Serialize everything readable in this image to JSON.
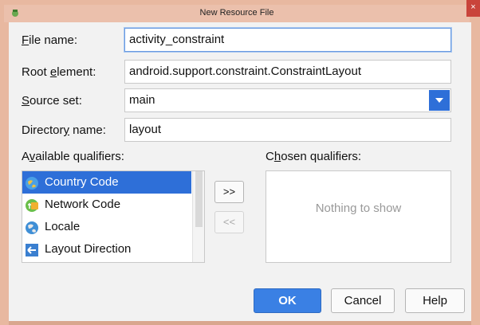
{
  "window": {
    "title": "New Resource File",
    "close_label": "×"
  },
  "form": {
    "file_name_label_prefix": "F",
    "file_name_label_rest": "ile name:",
    "file_name_value": "activity_constraint",
    "root_element_label_prefix": "Root ",
    "root_element_label_mnemonic": "e",
    "root_element_label_rest": "lement:",
    "root_element_value": "android.support.constraint.ConstraintLayout",
    "source_set_label_prefix": "S",
    "source_set_label_rest": "ource set:",
    "source_set_value": "main",
    "directory_label_prefix": "Director",
    "directory_label_mnemonic": "y",
    "directory_label_rest": " name:",
    "directory_value": "layout"
  },
  "qualifiers": {
    "available_label_prefix": "A",
    "available_label_mnemonic": "v",
    "available_label_rest": "ailable qualifiers:",
    "chosen_label_prefix": "C",
    "chosen_label_mnemonic": "h",
    "chosen_label_rest": "osen qualifiers:",
    "available_items": [
      {
        "label": "Country Code",
        "icon": "country-code-icon",
        "selected": true
      },
      {
        "label": "Network Code",
        "icon": "network-code-icon",
        "selected": false
      },
      {
        "label": "Locale",
        "icon": "locale-icon",
        "selected": false
      },
      {
        "label": "Layout Direction",
        "icon": "layout-direction-icon",
        "selected": false
      }
    ],
    "add_button": ">>",
    "remove_button": "<<",
    "chosen_empty_text": "Nothing to show"
  },
  "buttons": {
    "ok": "OK",
    "cancel": "Cancel",
    "help": "Help"
  },
  "colors": {
    "accent": "#2e6fd8",
    "title_bar": "#ebc0ac",
    "close": "#c9443b"
  }
}
